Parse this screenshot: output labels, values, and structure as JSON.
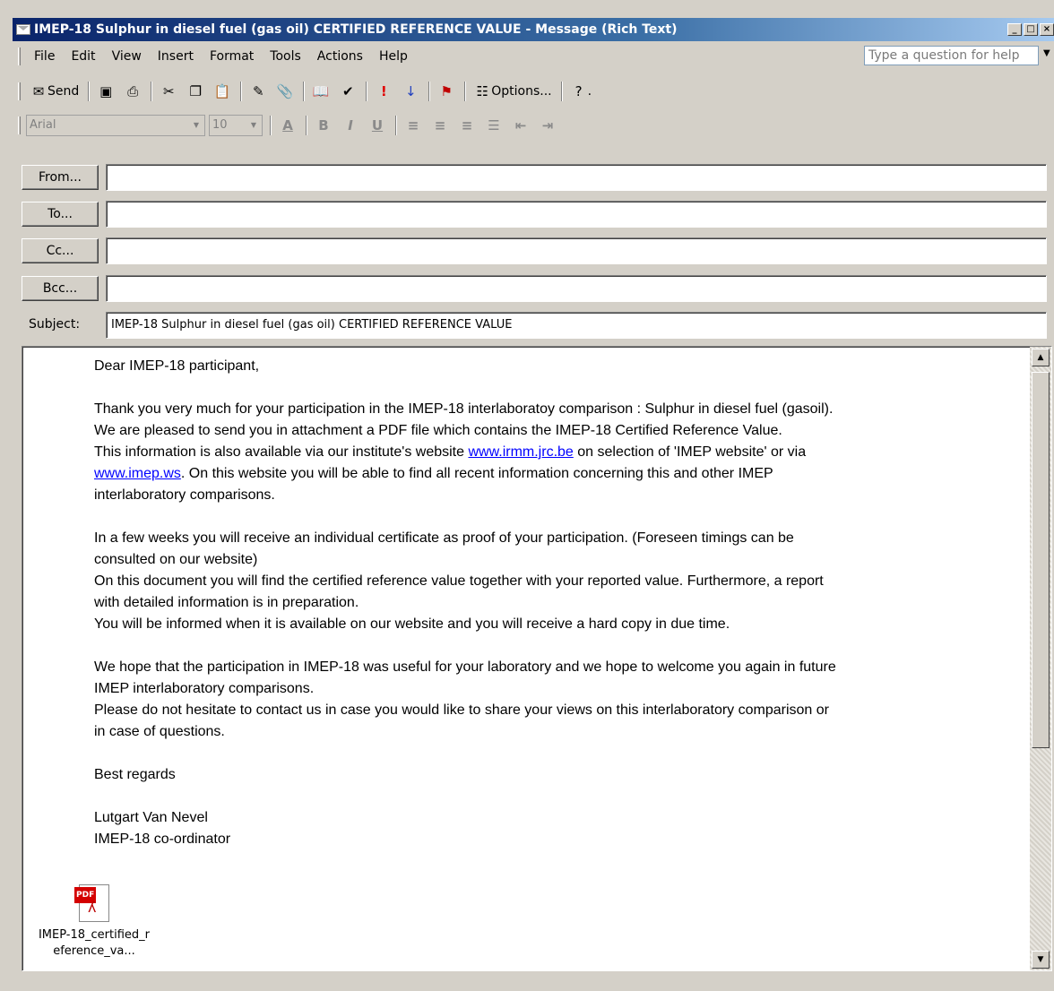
{
  "window": {
    "title": "IMEP-18 Sulphur in diesel fuel (gas oil)  CERTIFIED REFERENCE VALUE - Message (Rich Text)",
    "controls": [
      "_",
      "□",
      "×"
    ]
  },
  "menubar": {
    "items": [
      "File",
      "Edit",
      "View",
      "Insert",
      "Format",
      "Tools",
      "Actions",
      "Help"
    ],
    "help_placeholder": "Type a question for help"
  },
  "toolbar": {
    "send_label": "Send",
    "options_label": "Options...",
    "icons": [
      "send-icon",
      "save-icon",
      "print-icon",
      "cut-icon",
      "copy-icon",
      "paste-icon",
      "edit-icon",
      "insert-file-icon",
      "attach-icon",
      "address-book-icon",
      "check-names-icon",
      "importance-high-icon",
      "importance-low-icon",
      "flag-icon",
      "options-icon",
      "help-icon"
    ]
  },
  "format_toolbar": {
    "font": "Arial",
    "size": "10"
  },
  "header": {
    "from_label": "From...",
    "to_label": "To...",
    "cc_label": "Cc...",
    "bcc_label": "Bcc...",
    "from_value": "",
    "to_value": "",
    "cc_value": "",
    "bcc_value": "",
    "subject_label": "Subject:",
    "subject_value": "IMEP-18 Sulphur in diesel fuel (gas oil)  CERTIFIED REFERENCE VALUE"
  },
  "message": {
    "greeting": "Dear IMEP-18 participant,",
    "p1_line1": "Thank you very much for your participation in the IMEP-18 interlaboratoy comparison : Sulphur in diesel fuel (gasoil).",
    "p1_line2": "We are pleased to send you in attachment a PDF file which contains the IMEP-18 Certified Reference Value.",
    "p1_line3_pre": "This information is also available via our institute's website ",
    "link1": "www.irmm.jrc.be",
    "p1_line3_post": " on selection of 'IMEP website' or via",
    "link2": "www.imep.ws",
    "p1_line4_post": ". On this website you will be able to find all recent information concerning this and other IMEP",
    "p1_line5": "interlaboratory comparisons.",
    "p2_line1": "In a few weeks you will receive an individual certificate as proof of your participation. (Foreseen timings can be",
    "p2_line2": "consulted on our website)",
    "p2_line3": "On this document you will find the certified reference value together with your reported value. Furthermore, a report",
    "p2_line4": "with detailed information is in preparation.",
    "p2_line5": "You will be informed when it is available on our website and you will receive a hard copy in due time.",
    "p3_line1": "We hope that the participation in IMEP-18 was useful for your laboratory and we hope to welcome you again in future",
    "p3_line2": "IMEP interlaboratory comparisons.",
    "p3_line3": "Please do not hesitate to contact us in case you would like to share your views on this interlaboratory comparison or",
    "p3_line4": "in case of questions.",
    "closing": "Best regards",
    "sender_name": "Lutgart Van Nevel",
    "sender_role": "IMEP-18 co-ordinator"
  },
  "attachment": {
    "badge": "PDF",
    "name_line1": "IMEP-18_certified_r",
    "name_line2": "eference_va..."
  }
}
